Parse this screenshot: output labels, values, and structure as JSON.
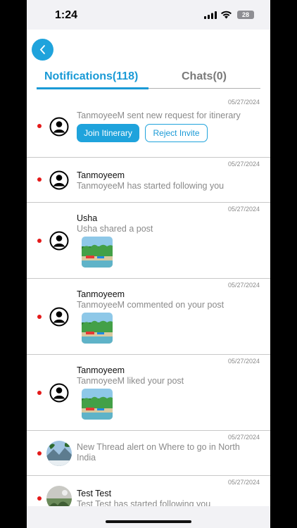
{
  "status_bar": {
    "time": "1:24",
    "battery": "28"
  },
  "header": {
    "back_icon": "chevron-left-icon",
    "tabs": [
      {
        "label": "Notifications(118)",
        "active": true
      },
      {
        "label": "Chats(0)",
        "active": false
      }
    ]
  },
  "colors": {
    "accent": "#1fa3dc",
    "unread_dot": "#e41a1a"
  },
  "notifications": [
    {
      "date": "05/27/2024",
      "name": "",
      "message": "TanmoyeeM sent new request for itinerary",
      "unread": true,
      "actions": {
        "join": "Join Itinerary",
        "reject": "Reject Invite"
      }
    },
    {
      "date": "05/27/2024",
      "name": "Tanmoyeem",
      "message": "TanmoyeeM has started following you",
      "unread": true
    },
    {
      "date": "05/27/2024",
      "name": "Usha",
      "message": "Usha shared a post",
      "unread": true,
      "thumbnail": "beach-photo"
    },
    {
      "date": "05/27/2024",
      "name": "Tanmoyeem",
      "message": "TanmoyeeM commented on  your post",
      "unread": true,
      "thumbnail": "beach-photo"
    },
    {
      "date": "05/27/2024",
      "name": "Tanmoyeem",
      "message": "TanmoyeeM liked your post",
      "unread": true,
      "thumbnail": "beach-photo"
    },
    {
      "date": "05/27/2024",
      "name": "",
      "message": "New Thread alert on Where to go in North India",
      "unread": true,
      "avatar": "photo"
    },
    {
      "date": "05/27/2024",
      "name": "Test Test",
      "message": "Test Test  has started following you",
      "unread": true,
      "avatar": "photo"
    }
  ]
}
